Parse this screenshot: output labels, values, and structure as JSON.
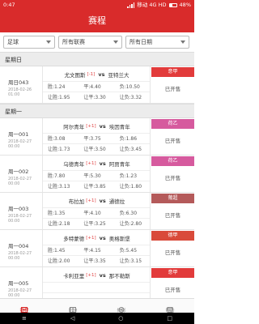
{
  "status_bar": {
    "time": "0:47",
    "network": "移动 4G HD",
    "battery": "48%",
    "battery_level": 0.48
  },
  "header": {
    "title": "赛程"
  },
  "filters": [
    {
      "value": "足球"
    },
    {
      "value": "所有联赛"
    },
    {
      "value": "所有日期"
    }
  ],
  "sections": [
    {
      "title": "星期日",
      "matches": [
        {
          "code": "周日043",
          "date": "2018-02-26",
          "time": "01:00",
          "home": "尤文图斯",
          "handicap": "[-1]",
          "vs": "vs",
          "away": "亚特兰大",
          "odds1": [
            "胜:1.24",
            "平:4.40",
            "负:10.50"
          ],
          "odds2": [
            "让胜:1.95",
            "让平:3.30",
            "让负:3.32"
          ],
          "league": "意甲",
          "league_color": "#e23b3b",
          "status": "已开售"
        }
      ]
    },
    {
      "title": "星期一",
      "matches": [
        {
          "code": "周一001",
          "date": "2018-02-27",
          "time": "00:00",
          "home": "阿尔青年",
          "handicap": "[+1]",
          "vs": "vs",
          "away": "埃因青年",
          "odds1": [
            "胜:3.08",
            "平:3.75",
            "负:1.86"
          ],
          "odds2": [
            "让胜:1.73",
            "让平:3.50",
            "让负:3.45"
          ],
          "league": "荷乙",
          "league_color": "#d65a9e",
          "status": "已开售"
        },
        {
          "code": "周一002",
          "date": "2018-02-27",
          "time": "00:00",
          "home": "乌德青年",
          "handicap": "[+1]",
          "vs": "vs",
          "away": "阿贾青年",
          "odds1": [
            "胜:7.80",
            "平:5.30",
            "负:1.23"
          ],
          "odds2": [
            "让胜:3.13",
            "让平:3.85",
            "让负:1.80"
          ],
          "league": "荷乙",
          "league_color": "#d65a9e",
          "status": "已开售"
        },
        {
          "code": "周一003",
          "date": "2018-02-27",
          "time": "00:00",
          "home": "布拉加",
          "handicap": "[+1]",
          "vs": "vs",
          "away": "通德拉",
          "odds1": [
            "胜:1.35",
            "平:4.10",
            "负:6.30"
          ],
          "odds2": [
            "让胜:2.18",
            "让平:3.25",
            "让负:2.80"
          ],
          "league": "葡超",
          "league_color": "#b45a5a",
          "status": "已开售"
        },
        {
          "code": "周一004",
          "date": "2018-02-27",
          "time": "00:00",
          "home": "多特蒙德",
          "handicap": "[+1]",
          "vs": "vs",
          "away": "奥格斯堡",
          "odds1": [
            "胜:1.45",
            "平:4.15",
            "负:5.45"
          ],
          "odds2": [
            "让胜:2.00",
            "让平:3.35",
            "让负:3.15"
          ],
          "league": "德甲",
          "league_color": "#d94a3a",
          "status": "已开售"
        },
        {
          "code": "周一005",
          "date": "2018-02-27",
          "time": "00:00",
          "home": "卡利亚里",
          "handicap": "[+1]",
          "vs": "vs",
          "away": "那不勒斯",
          "odds1": [
            "",
            "",
            ""
          ],
          "odds2": [
            "",
            "",
            ""
          ],
          "league": "意甲",
          "league_color": "#e23b3b",
          "status": "已开售"
        }
      ]
    }
  ],
  "tabs": [
    {
      "label": "赛程",
      "icon": "schedule-icon",
      "active": true
    },
    {
      "label": "比分",
      "icon": "score-icon",
      "active": false
    },
    {
      "label": "体彩",
      "icon": "lottery-icon",
      "active": false
    },
    {
      "label": "帮助",
      "icon": "help-icon",
      "active": false
    }
  ],
  "nav": {
    "back": "◁",
    "home": "○",
    "recent": "□",
    "menu": "≡"
  }
}
